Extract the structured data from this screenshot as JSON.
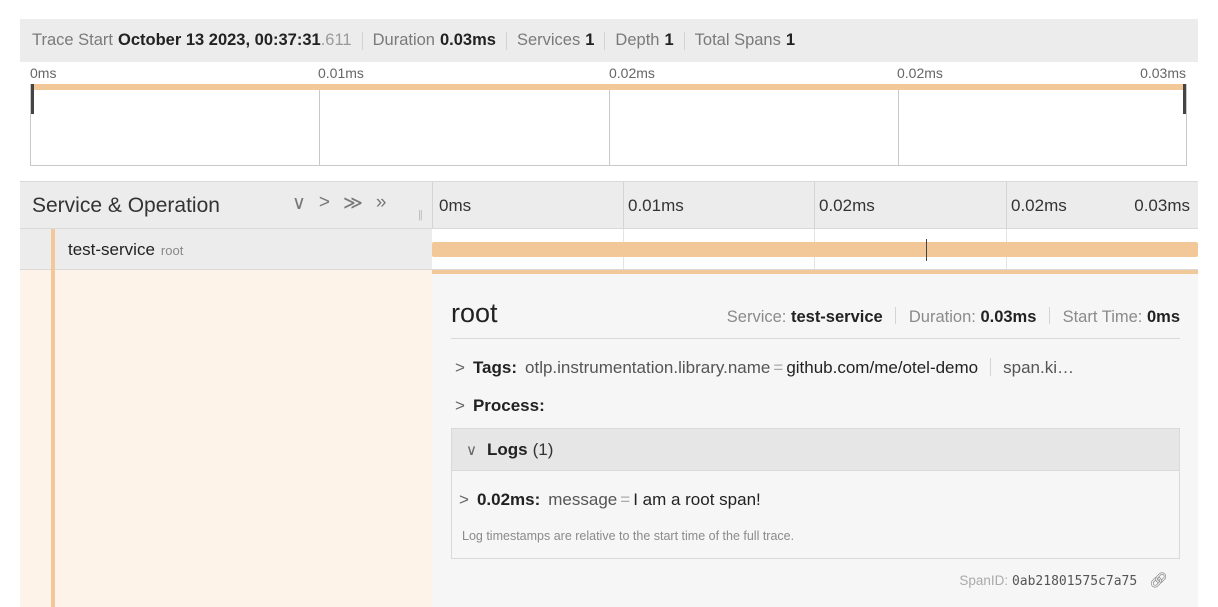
{
  "header": {
    "trace_start_label": "Trace Start",
    "trace_start_value": "October 13 2023, 00:37:31",
    "trace_start_ms": ".611",
    "duration_label": "Duration",
    "duration_value": "0.03ms",
    "services_label": "Services",
    "services_value": "1",
    "depth_label": "Depth",
    "depth_value": "1",
    "total_spans_label": "Total Spans",
    "total_spans_value": "1"
  },
  "minimap": {
    "ticks": [
      "0ms",
      "0.01ms",
      "0.02ms",
      "0.02ms",
      "0.03ms"
    ]
  },
  "timeline": {
    "title": "Service & Operation",
    "ticks": [
      "0ms",
      "0.01ms",
      "0.02ms",
      "0.02ms",
      "0.03ms"
    ]
  },
  "span": {
    "service": "test-service",
    "operation": "root"
  },
  "detail": {
    "title": "root",
    "service_label": "Service:",
    "service_value": "test-service",
    "duration_label": "Duration:",
    "duration_value": "0.03ms",
    "start_label": "Start Time:",
    "start_value": "0ms",
    "tags_label": "Tags:",
    "tag_key": "otlp.instrumentation.library.name",
    "tag_eq": "=",
    "tag_value": "github.com/me/otel-demo",
    "tag_more": "span.ki…",
    "process_label": "Process:",
    "logs_label": "Logs",
    "logs_count": "(1)",
    "log_time": "0.02ms:",
    "log_key": "message",
    "log_value": "I am a root span!",
    "log_note": "Log timestamps are relative to the start time of the full trace.",
    "span_id_label": "SpanID:",
    "span_id_value": "0ab21801575c7a75"
  }
}
